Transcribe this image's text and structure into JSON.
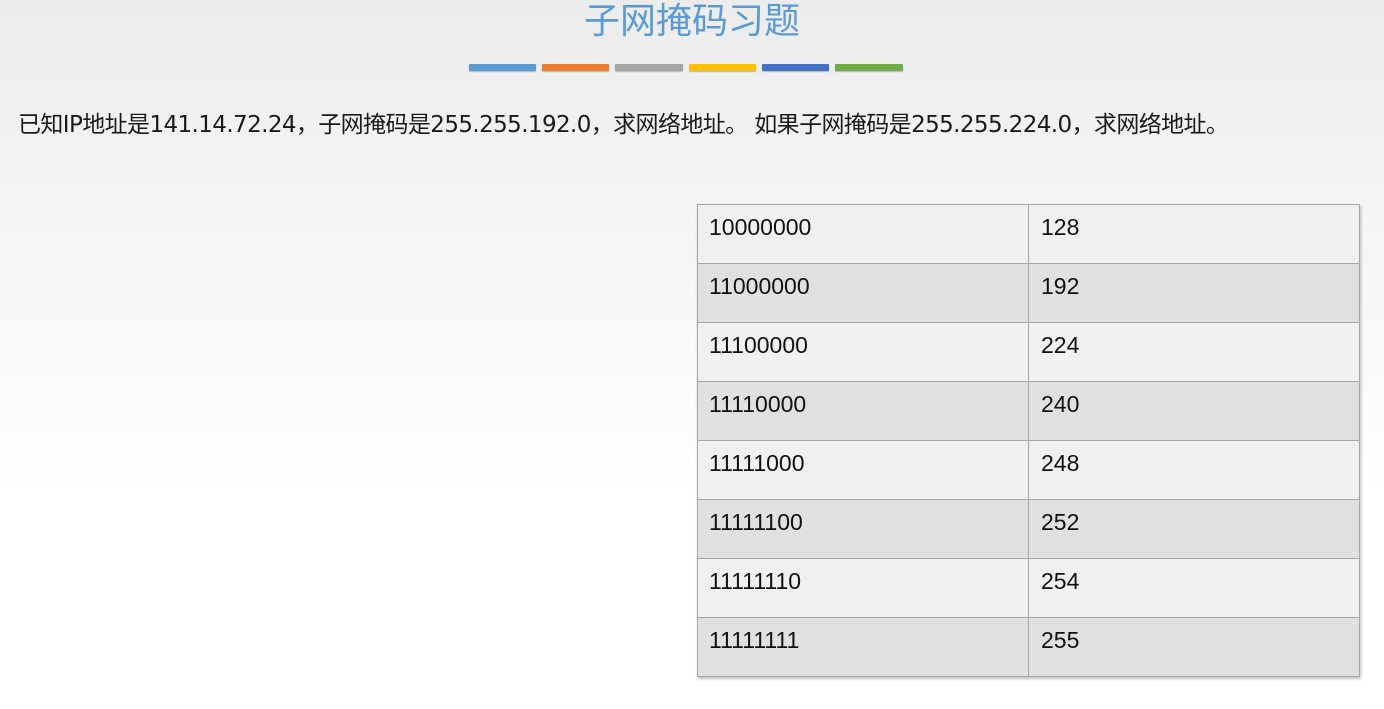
{
  "slide": {
    "title": "子网掩码习题",
    "accent_colors": [
      "#5b9bd5",
      "#ed7d31",
      "#a5a5a5",
      "#ffc000",
      "#4472c4",
      "#70ad47"
    ],
    "question": "已知IP地址是141.14.72.24，子网掩码是255.255.192.0，求网络地址。  如果子网掩码是255.255.224.0，求网络地址。"
  },
  "table": {
    "rows": [
      {
        "binary": "10000000",
        "decimal": "128"
      },
      {
        "binary": "11000000",
        "decimal": "192"
      },
      {
        "binary": "11100000",
        "decimal": "224"
      },
      {
        "binary": "11110000",
        "decimal": "240"
      },
      {
        "binary": "11111000",
        "decimal": "248"
      },
      {
        "binary": "11111100",
        "decimal": "252"
      },
      {
        "binary": "11111110",
        "decimal": "254"
      },
      {
        "binary": "11111111",
        "decimal": "255"
      }
    ]
  }
}
